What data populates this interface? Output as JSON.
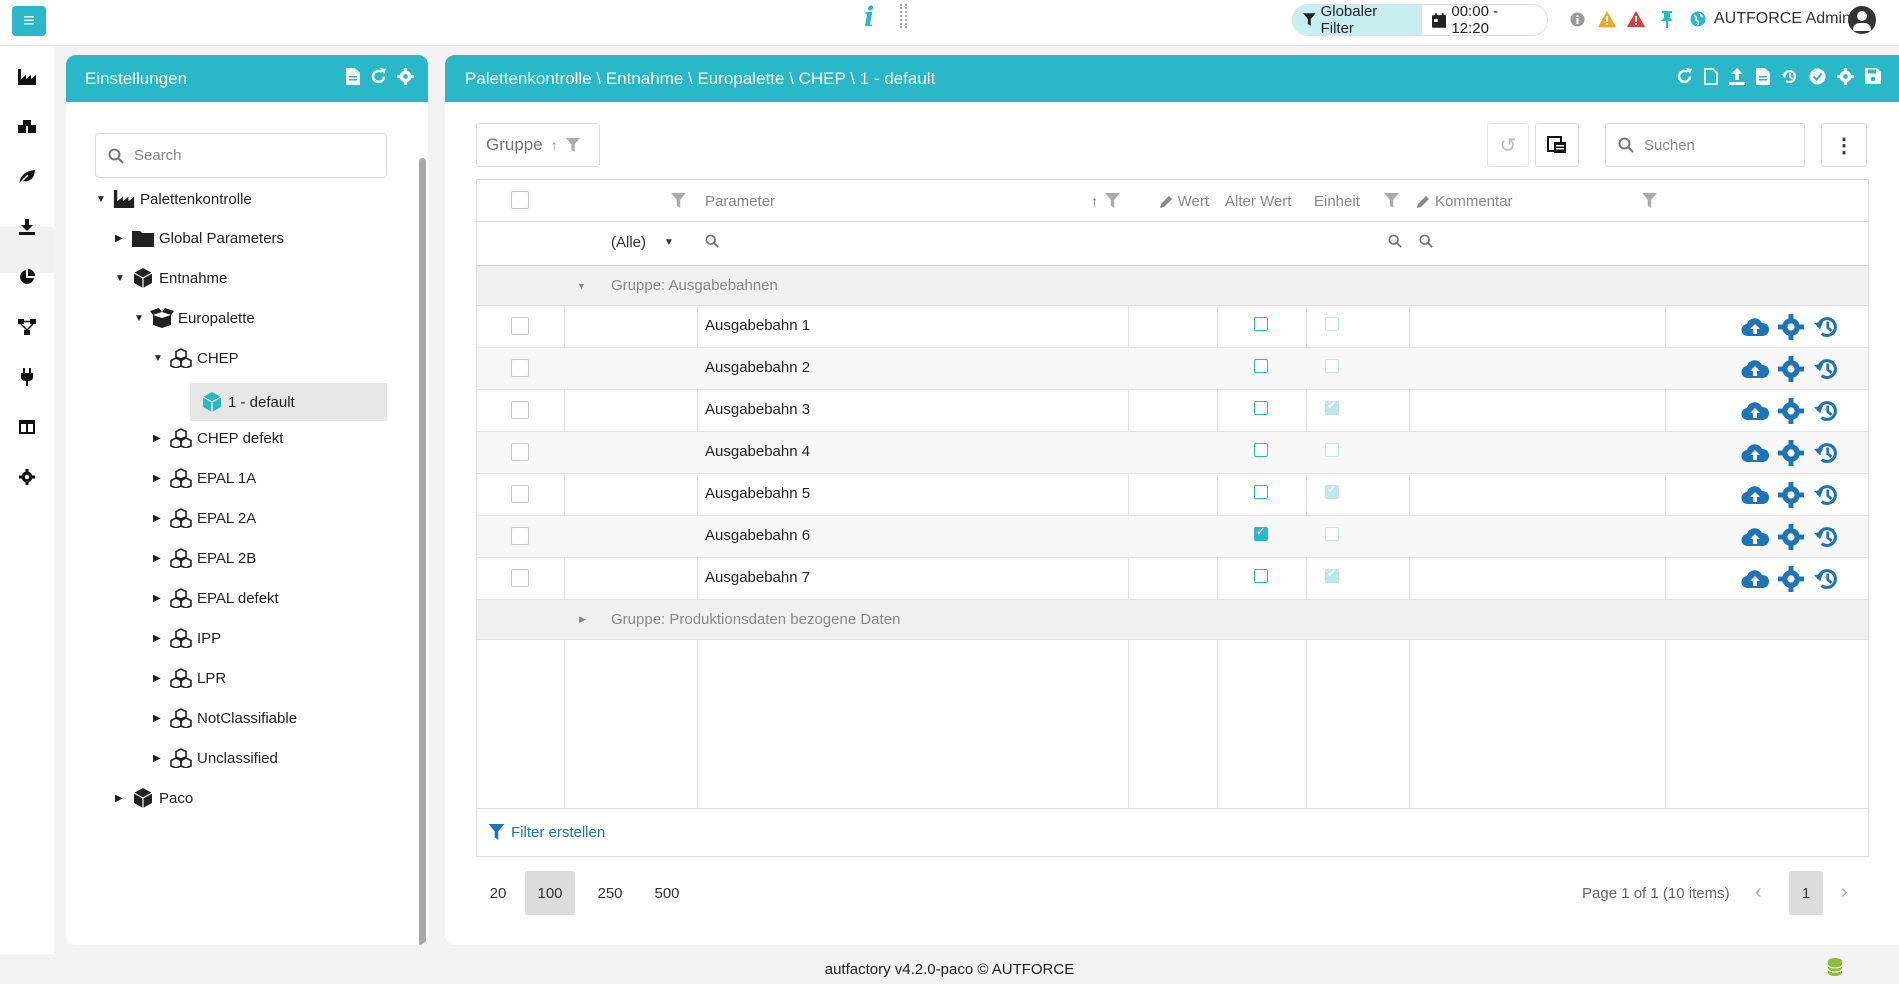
{
  "topbar": {
    "global_filter_label": "Globaler Filter",
    "time_range": "00:00 - 12:20",
    "user_name": "AUTFORCE Admin",
    "icons": [
      "menu-icon",
      "info-icon",
      "dots-icon",
      "filter-icon",
      "calendar-icon",
      "info-circle-icon",
      "warning-icon",
      "error-icon",
      "pin-icon",
      "globe-icon",
      "user-avatar-icon"
    ]
  },
  "leftnav": {
    "items": [
      "factory-icon",
      "boxes-icon",
      "leaf-icon",
      "download-icon",
      "pie-chart-icon",
      "network-icon",
      "plug-icon",
      "table-icon",
      "gear-icon"
    ],
    "active_index": 3
  },
  "settings": {
    "title": "Einstellungen",
    "search_placeholder": "Search",
    "tree": [
      {
        "label": "Palettenkontrolle",
        "level": 0,
        "expanded": true,
        "icon": "factory-icon"
      },
      {
        "label": "Global Parameters",
        "level": 1,
        "expanded": false,
        "icon": "folder-icon"
      },
      {
        "label": "Entnahme",
        "level": 1,
        "expanded": true,
        "icon": "cube-icon"
      },
      {
        "label": "Europalette",
        "level": 2,
        "expanded": true,
        "icon": "open-box-icon"
      },
      {
        "label": "CHEP",
        "level": 3,
        "expanded": true,
        "icon": "cubes-icon"
      },
      {
        "label": "1 - default",
        "level": 4,
        "selected": true,
        "icon": "cube-blue-icon"
      },
      {
        "label": "CHEP defekt",
        "level": 3,
        "expanded": false,
        "icon": "cubes-icon"
      },
      {
        "label": "EPAL 1A",
        "level": 3,
        "expanded": false,
        "icon": "cubes-icon"
      },
      {
        "label": "EPAL 2A",
        "level": 3,
        "expanded": false,
        "icon": "cubes-icon"
      },
      {
        "label": "EPAL 2B",
        "level": 3,
        "expanded": false,
        "icon": "cubes-icon"
      },
      {
        "label": "EPAL defekt",
        "level": 3,
        "expanded": false,
        "icon": "cubes-icon"
      },
      {
        "label": "IPP",
        "level": 3,
        "expanded": false,
        "icon": "cubes-icon"
      },
      {
        "label": "LPR",
        "level": 3,
        "expanded": false,
        "icon": "cubes-icon"
      },
      {
        "label": "NotClassifiable",
        "level": 3,
        "expanded": false,
        "icon": "cubes-icon"
      },
      {
        "label": "Unclassified",
        "level": 3,
        "expanded": false,
        "icon": "cubes-icon"
      },
      {
        "label": "Paco",
        "level": 1,
        "expanded": false,
        "icon": "cube-icon"
      }
    ]
  },
  "main": {
    "breadcrumb": "Palettenkontrolle \\ Entnahme \\ Europalette \\ CHEP \\ 1 - default",
    "group_label": "Gruppe",
    "search_placeholder": "Suchen",
    "columns": {
      "parameter": "Parameter",
      "wert": "Wert",
      "alter_wert": "Alter Wert",
      "einheit": "Einheit",
      "kommentar": "Kommentar"
    },
    "filter_select": "(Alle)",
    "groups": [
      {
        "label": "Gruppe: Ausgabebahnen",
        "expanded": true
      },
      {
        "label": "Gruppe: Produktionsdaten bezogene Daten",
        "expanded": false
      }
    ],
    "rows": [
      {
        "parameter": "Ausgabebahn 1",
        "wert": false,
        "alter_wert": false
      },
      {
        "parameter": "Ausgabebahn 2",
        "wert": false,
        "alter_wert": false
      },
      {
        "parameter": "Ausgabebahn 3",
        "wert": false,
        "alter_wert": true
      },
      {
        "parameter": "Ausgabebahn 4",
        "wert": false,
        "alter_wert": false
      },
      {
        "parameter": "Ausgabebahn 5",
        "wert": false,
        "alter_wert": true
      },
      {
        "parameter": "Ausgabebahn 6",
        "wert": true,
        "alter_wert": false
      },
      {
        "parameter": "Ausgabebahn 7",
        "wert": false,
        "alter_wert": true
      }
    ],
    "filter_create": "Filter erstellen",
    "page_sizes": [
      "20",
      "100",
      "250",
      "500"
    ],
    "page_size_active": "100",
    "page_info": "Page 1 of 1 (10 items)",
    "current_page": "1"
  },
  "footer": {
    "text": "autfactory v4.2.0-paco © AUTFORCE"
  },
  "colors": {
    "accent": "#2ab7c7",
    "link": "#1f73b7",
    "warning": "#f5a623",
    "error": "#e0393e"
  }
}
